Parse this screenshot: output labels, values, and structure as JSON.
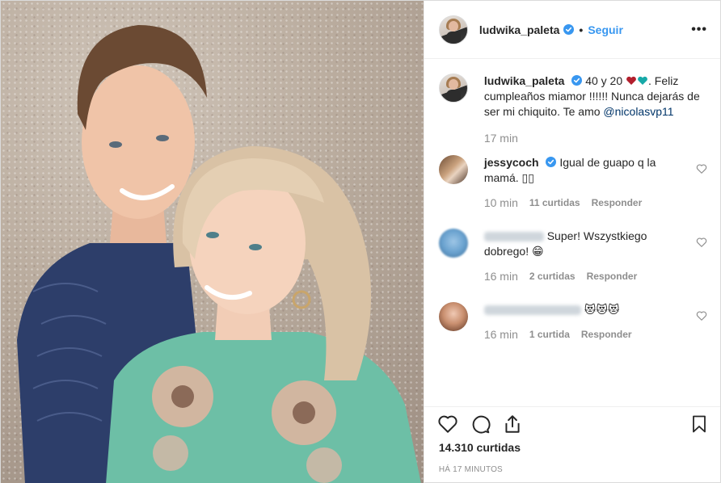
{
  "header": {
    "username": "ludwika_paleta",
    "dot": "•",
    "follow_label": "Seguir",
    "more_label": "•••"
  },
  "caption": {
    "username": "ludwika_paleta",
    "text_part1": "40 y 20",
    "text_part2": ". Feliz cumpleaños miamor !!!!!! Nunca dejarás de ser mi chiquito. Te amo",
    "mention": "@nicolasvp11",
    "time": "17 min"
  },
  "comments": [
    {
      "username": "jessycoch",
      "verified": true,
      "text": "Igual de guapo q la mamá. ▯▯",
      "time": "10 min",
      "likes": "11 curtidas",
      "reply": "Responder"
    },
    {
      "username": "",
      "verified": false,
      "text": "Super! Wszystkiego dobrego! 😁",
      "time": "16 min",
      "likes": "2 curtidas",
      "reply": "Responder"
    },
    {
      "username": "",
      "verified": false,
      "text": "😻😻😻",
      "time": "16 min",
      "likes": "1 curtida",
      "reply": "Responder"
    }
  ],
  "likes_count": "14.310 curtidas",
  "timestamp": "HÁ 17 MINUTOS",
  "colors": {
    "link": "#3897f0",
    "verified": "#3897f0",
    "heart_red": "#b21f2d",
    "heart_teal": "#17a9a8",
    "text": "#262626",
    "muted": "#8e8e8e"
  },
  "icons": [
    "verified-badge-icon",
    "more-options-icon",
    "like-heart-icon",
    "comment-icon",
    "share-icon",
    "bookmark-icon"
  ]
}
